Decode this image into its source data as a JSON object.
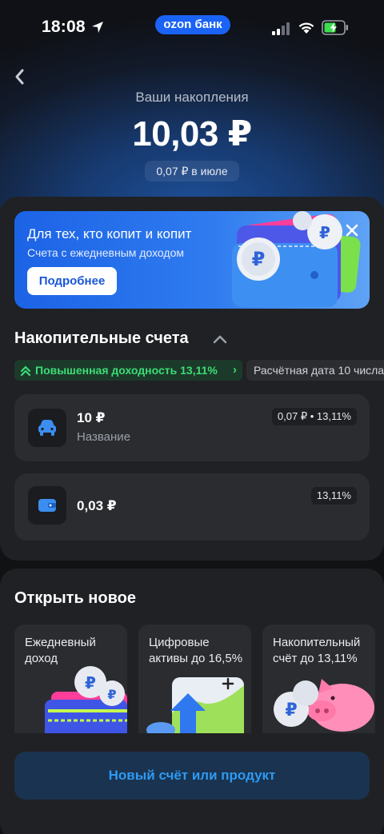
{
  "status_bar": {
    "time": "18:08",
    "carrier": "ozon банк"
  },
  "header": {
    "subtitle": "Ваши накопления",
    "balance": "10,03 ₽",
    "month_income": "0,07 ₽ в июле"
  },
  "promo": {
    "title": "Для тех, кто копит и копит",
    "subtitle": "Счета с ежедневным доходом",
    "button_label": "Подробнее"
  },
  "savings": {
    "title": "Накопительные счета",
    "chip_yield": "Повышенная доходность 13,11%",
    "chip_date": "Расчётная дата 10 числа",
    "accounts": [
      {
        "amount": "10 ₽",
        "name": "Название",
        "badge": "0,07 ₽ • 13,11%",
        "icon": "car-icon"
      },
      {
        "amount": "0,03 ₽",
        "name": "",
        "badge": "13,11%",
        "icon": "wallet-icon"
      }
    ]
  },
  "open_new": {
    "title": "Открыть новое",
    "products": [
      {
        "label": "Ежедневный доход"
      },
      {
        "label": "Цифровые активы до 16,5%"
      },
      {
        "label": "Накопительный счёт до 13,11%"
      }
    ]
  },
  "new_button_label": "Новый счёт или продукт",
  "colors": {
    "accent": "#1a63f5",
    "positive": "#3ddc76",
    "link": "#2d9af2"
  }
}
